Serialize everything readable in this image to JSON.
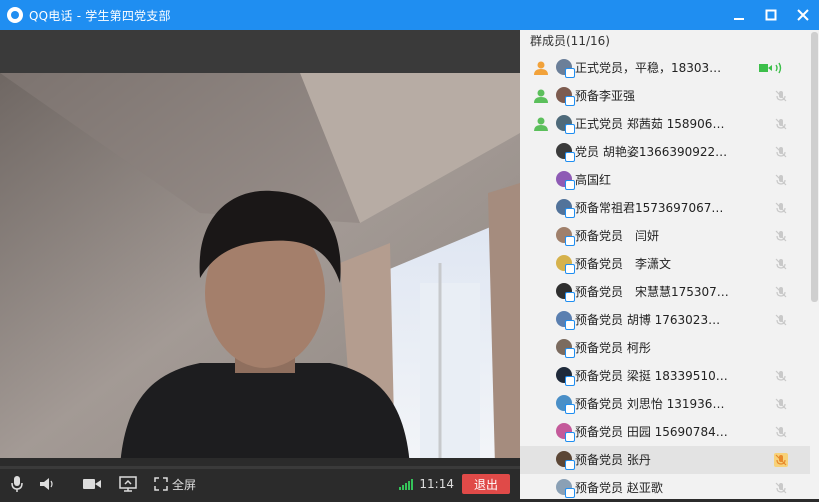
{
  "window": {
    "title": "QQ电话 - 学生第四党支部",
    "controls": [
      "minimize",
      "maximize",
      "close"
    ]
  },
  "panel": {
    "header": "群成员(11/16)",
    "members": [
      {
        "name": "正式党员，平稳，18303…",
        "role": "admin",
        "mic": "speaking",
        "active": false
      },
      {
        "name": "预备李亚强",
        "role": "admin",
        "mic": "muted",
        "active": false
      },
      {
        "name": "正式党员 郑茜茹 158906…",
        "role": "admin",
        "mic": "muted",
        "active": false
      },
      {
        "name": "党员 胡艳姿1366390922…",
        "role": "none",
        "mic": "muted",
        "active": false
      },
      {
        "name": "高国红",
        "role": "none",
        "mic": "muted",
        "active": false
      },
      {
        "name": "预备常祖君1573697067…",
        "role": "none",
        "mic": "muted",
        "active": false
      },
      {
        "name": "预备党员　闫妍",
        "role": "none",
        "mic": "muted",
        "active": false
      },
      {
        "name": "预备党员　李潇文",
        "role": "none",
        "mic": "muted",
        "active": false
      },
      {
        "name": "预备党员　宋慧慧175307…",
        "role": "none",
        "mic": "muted",
        "active": false
      },
      {
        "name": "预备党员 胡博 1763023…",
        "role": "none",
        "mic": "muted",
        "active": false
      },
      {
        "name": "预备党员 柯彤",
        "role": "none",
        "mic": "none",
        "active": false
      },
      {
        "name": "预备党员 梁挺 18339510…",
        "role": "none",
        "mic": "muted",
        "active": false
      },
      {
        "name": "预备党员 刘思怡 131936…",
        "role": "none",
        "mic": "muted",
        "active": false
      },
      {
        "name": "预备党员 田园 15690784…",
        "role": "none",
        "mic": "muted",
        "active": false
      },
      {
        "name": "预备党员 张丹",
        "role": "none",
        "mic": "muted-highlight",
        "active": true
      },
      {
        "name": "预备党员 赵亚歌",
        "role": "none",
        "mic": "muted",
        "active": false
      }
    ]
  },
  "controls": {
    "fullscreen_label": "全屏",
    "call_time": "11:14",
    "exit_label": "退出",
    "icons": [
      "microphone-icon",
      "speaker-icon",
      "camera-icon",
      "screen-share-icon",
      "fullscreen-icon"
    ]
  },
  "colors": {
    "titlebar": "#1f8ef1",
    "exit": "#e04a48",
    "signal": "#35c35a"
  }
}
